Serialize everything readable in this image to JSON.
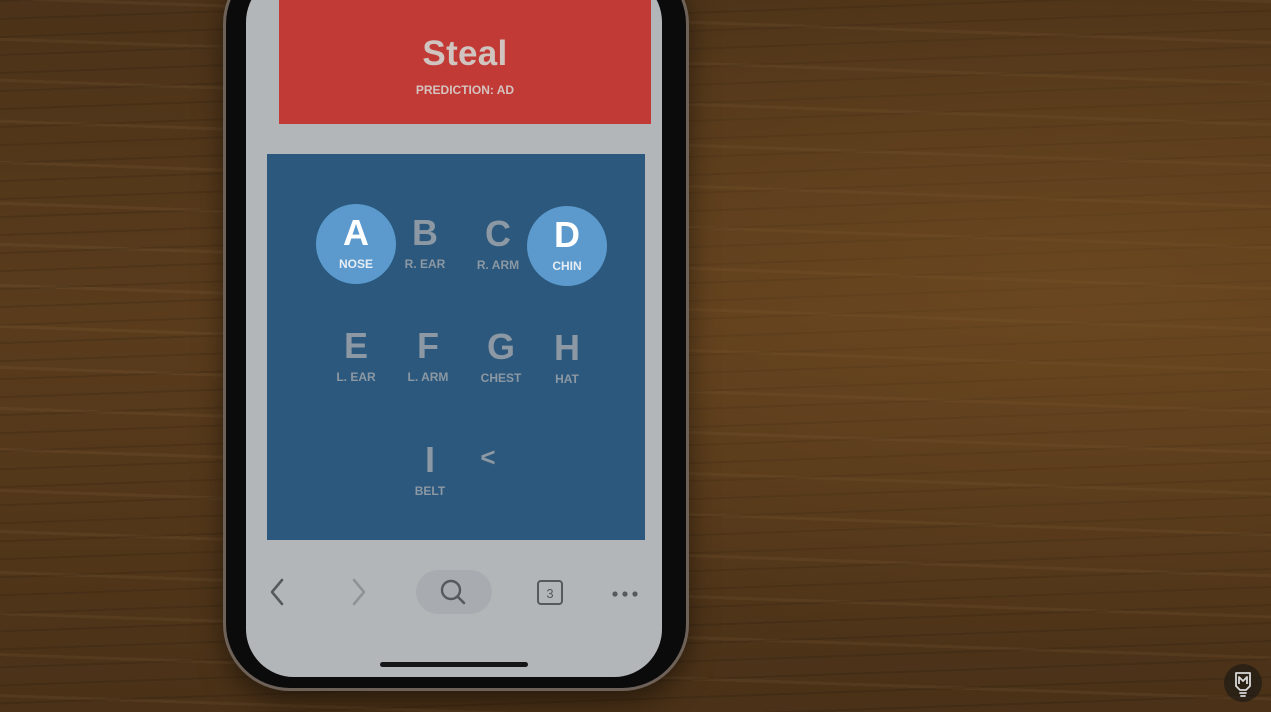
{
  "result_card": {
    "title": "Steal",
    "subtitle": "PREDICTION: AD",
    "color": "#c23a35"
  },
  "keypad": {
    "background": "#2b587c",
    "selected_color": "#5c9acd",
    "keys": [
      {
        "letter": "A",
        "label": "NOSE",
        "selected": true
      },
      {
        "letter": "B",
        "label": "R. EAR",
        "selected": false
      },
      {
        "letter": "C",
        "label": "R. ARM",
        "selected": false
      },
      {
        "letter": "D",
        "label": "CHIN",
        "selected": true
      },
      {
        "letter": "E",
        "label": "L. EAR",
        "selected": false
      },
      {
        "letter": "F",
        "label": "L. ARM",
        "selected": false
      },
      {
        "letter": "G",
        "label": "CHEST",
        "selected": false
      },
      {
        "letter": "H",
        "label": "HAT",
        "selected": false
      },
      {
        "letter": "I",
        "label": "BELT",
        "selected": false
      }
    ],
    "backspace_glyph": "<"
  },
  "browser_toolbar": {
    "back_icon": "chevron-left-icon",
    "forward_icon": "chevron-right-icon",
    "search_icon": "search-icon",
    "tabs_count": "3",
    "more_icon": "more-dots-icon"
  }
}
